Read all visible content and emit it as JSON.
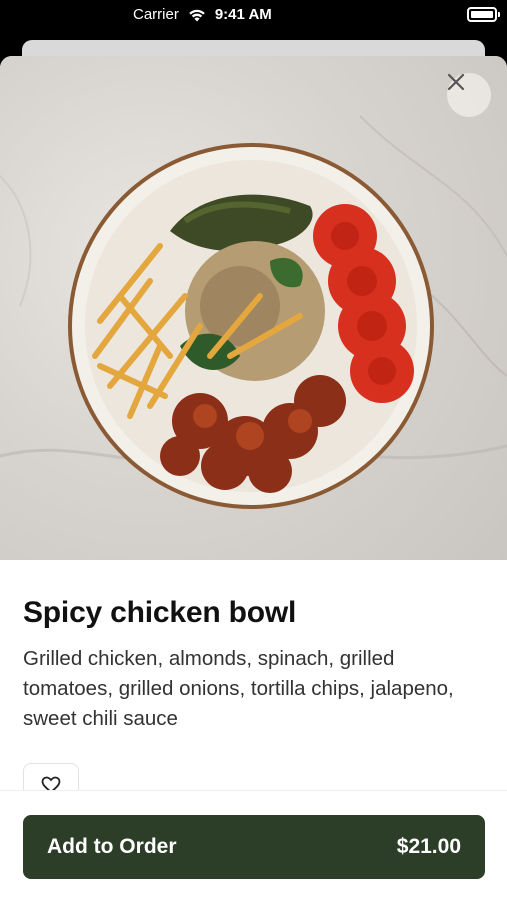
{
  "status_bar": {
    "carrier": "Carrier",
    "time": "9:41 AM"
  },
  "item": {
    "name": "Spicy chicken bowl",
    "description": "Grilled chicken, almonds, spinach, grilled tomatoes, grilled onions, tortilla chips, jalapeno, sweet chili sauce",
    "image_subject": "bowl-of-food-photo"
  },
  "actions": {
    "close_icon": "close-icon",
    "favorite_icon": "heart-outline-icon",
    "add_label": "Add to Order",
    "price": "$21.00"
  },
  "colors": {
    "primary_button": "#2c3d28",
    "text": "#111111",
    "status_bar_bg": "#000000"
  }
}
